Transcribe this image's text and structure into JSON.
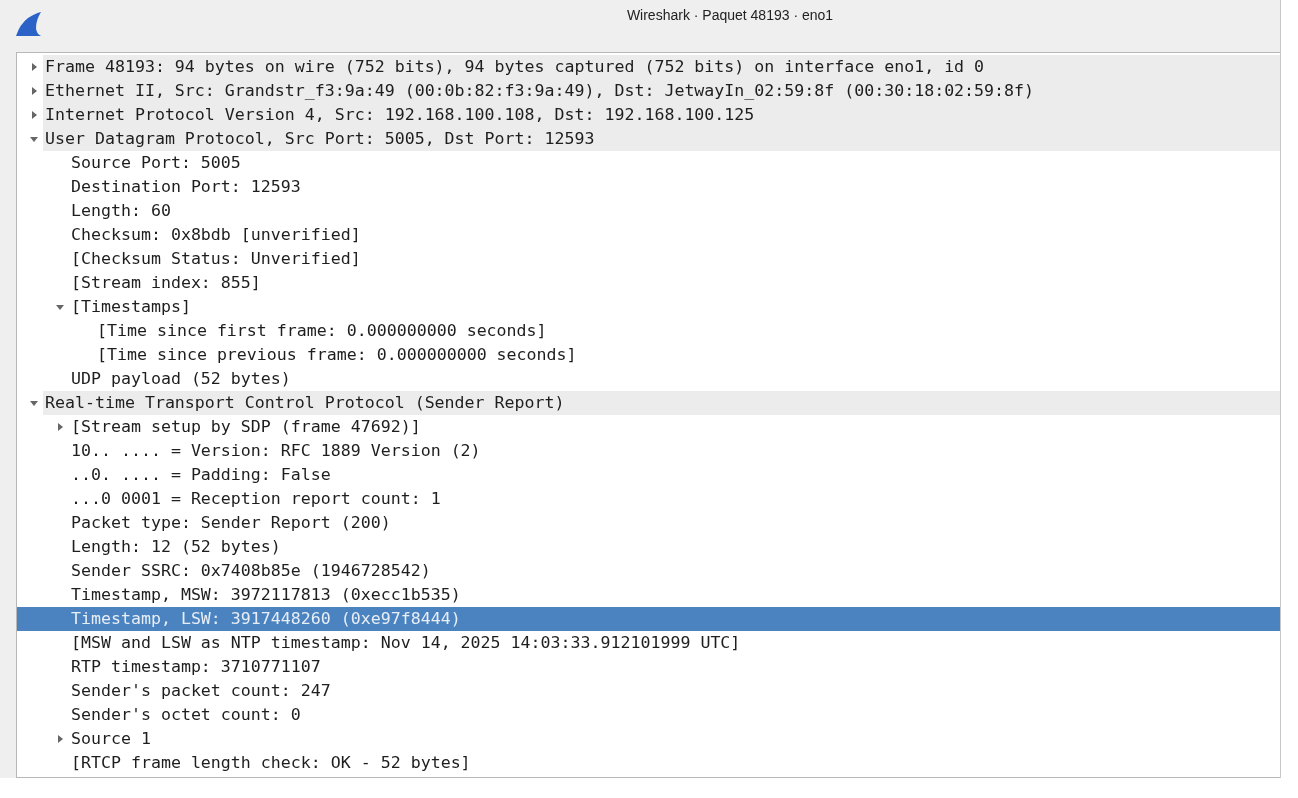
{
  "window": {
    "title": "Wireshark · Paquet 48193 · eno1"
  },
  "tree": [
    {
      "label": "Frame 48193: 94 bytes on wire (752 bits), 94 bytes captured (752 bits) on interface eno1, id 0",
      "kind": "node",
      "expanded": false,
      "selected": false
    },
    {
      "label": "Ethernet II, Src: Grandstr_f3:9a:49 (00:0b:82:f3:9a:49), Dst: JetwayIn_02:59:8f (00:30:18:02:59:8f)",
      "kind": "node",
      "expanded": false,
      "selected": false
    },
    {
      "label": "Internet Protocol Version 4, Src: 192.168.100.108, Dst: 192.168.100.125",
      "kind": "node",
      "expanded": false,
      "selected": false
    },
    {
      "label": "User Datagram Protocol, Src Port: 5005, Dst Port: 12593",
      "kind": "node",
      "expanded": true,
      "selected": false,
      "children": [
        {
          "label": "Source Port: 5005",
          "kind": "leaf",
          "selected": false
        },
        {
          "label": "Destination Port: 12593",
          "kind": "leaf",
          "selected": false
        },
        {
          "label": "Length: 60",
          "kind": "leaf",
          "selected": false
        },
        {
          "label": "Checksum: 0x8bdb [unverified]",
          "kind": "leaf",
          "selected": false
        },
        {
          "label": "[Checksum Status: Unverified]",
          "kind": "leaf",
          "selected": false
        },
        {
          "label": "[Stream index: 855]",
          "kind": "leaf",
          "selected": false
        },
        {
          "label": "[Timestamps]",
          "kind": "node",
          "expanded": true,
          "selected": false,
          "children": [
            {
              "label": "[Time since first frame: 0.000000000 seconds]",
              "kind": "leaf",
              "selected": false
            },
            {
              "label": "[Time since previous frame: 0.000000000 seconds]",
              "kind": "leaf",
              "selected": false
            }
          ]
        },
        {
          "label": "UDP payload (52 bytes)",
          "kind": "leaf",
          "selected": false
        }
      ]
    },
    {
      "label": "Real-time Transport Control Protocol (Sender Report)",
      "kind": "node",
      "expanded": true,
      "selected": false,
      "children": [
        {
          "label": "[Stream setup by SDP (frame 47692)]",
          "kind": "node",
          "expanded": false,
          "selected": false
        },
        {
          "label": "10.. .... = Version: RFC 1889 Version (2)",
          "kind": "leaf",
          "selected": false
        },
        {
          "label": "..0. .... = Padding: False",
          "kind": "leaf",
          "selected": false
        },
        {
          "label": "...0 0001 = Reception report count: 1",
          "kind": "leaf",
          "selected": false
        },
        {
          "label": "Packet type: Sender Report (200)",
          "kind": "leaf",
          "selected": false
        },
        {
          "label": "Length: 12 (52 bytes)",
          "kind": "leaf",
          "selected": false
        },
        {
          "label": "Sender SSRC: 0x7408b85e (1946728542)",
          "kind": "leaf",
          "selected": false
        },
        {
          "label": "Timestamp, MSW: 3972117813 (0xecc1b535)",
          "kind": "leaf",
          "selected": false
        },
        {
          "label": "Timestamp, LSW: 3917448260 (0xe97f8444)",
          "kind": "leaf",
          "selected": true
        },
        {
          "label": "[MSW and LSW as NTP timestamp: Nov 14, 2025 14:03:33.912101999 UTC]",
          "kind": "leaf",
          "selected": false
        },
        {
          "label": "RTP timestamp: 3710771107",
          "kind": "leaf",
          "selected": false
        },
        {
          "label": "Sender's packet count: 247",
          "kind": "leaf",
          "selected": false
        },
        {
          "label": "Sender's octet count: 0",
          "kind": "leaf",
          "selected": false
        },
        {
          "label": "Source 1",
          "kind": "node",
          "expanded": false,
          "selected": false
        },
        {
          "label": "[RTCP frame length check: OK - 52 bytes]",
          "kind": "leaf",
          "selected": false
        }
      ]
    }
  ]
}
